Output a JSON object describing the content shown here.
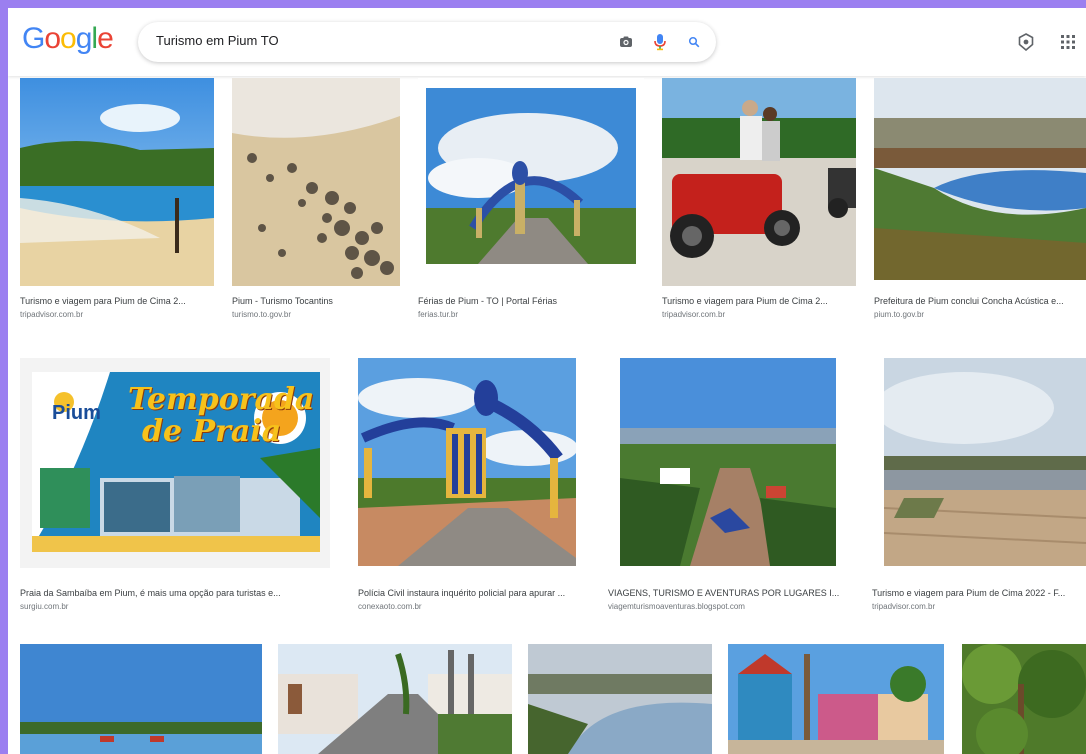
{
  "header": {
    "logo_letters": [
      {
        "ch": "G",
        "color": "#4285F4"
      },
      {
        "ch": "o",
        "color": "#EA4335"
      },
      {
        "ch": "o",
        "color": "#FBBC05"
      },
      {
        "ch": "g",
        "color": "#4285F4"
      },
      {
        "ch": "l",
        "color": "#34A853"
      },
      {
        "ch": "e",
        "color": "#EA4335"
      }
    ],
    "search_query": "Turismo em Pium TO",
    "icons": [
      "camera-icon",
      "microphone-icon",
      "search-icon",
      "settings-icon",
      "apps-grid-icon"
    ]
  },
  "results": [
    {
      "title": "Turismo e viagem para Pium de Cima 2...",
      "source": "tripadvisor.com.br"
    },
    {
      "title": "Pium - Turismo Tocantins",
      "source": "turismo.to.gov.br"
    },
    {
      "title": "Férias de Pium - TO | Portal Férias",
      "source": "ferias.tur.br"
    },
    {
      "title": "Turismo e viagem para Pium de Cima 2...",
      "source": "tripadvisor.com.br"
    },
    {
      "title": "Prefeitura de Pium conclui Concha Acústica e...",
      "source": "pium.to.gov.br"
    },
    {
      "title": "Praia da Sambaíba em Pium, é mais uma opção para turistas e...",
      "source": "surgiu.com.br"
    },
    {
      "title": "Polícia Civil instaura inquérito policial para apurar ...",
      "source": "conexaoto.com.br"
    },
    {
      "title": "VIAGENS, TURISMO E AVENTURAS POR LUGARES I...",
      "source": "viagemturismoaventuras.blogspot.com"
    },
    {
      "title": "Turismo e viagem para Pium de Cima 2022 - F...",
      "source": "tripadvisor.com.br"
    },
    {
      "title": "",
      "source": ""
    },
    {
      "title": "",
      "source": ""
    },
    {
      "title": "",
      "source": ""
    },
    {
      "title": "",
      "source": ""
    },
    {
      "title": "",
      "source": ""
    }
  ],
  "poster": {
    "brand": "Pium",
    "headline_1": "Temporada",
    "headline_2": "de Praia"
  }
}
